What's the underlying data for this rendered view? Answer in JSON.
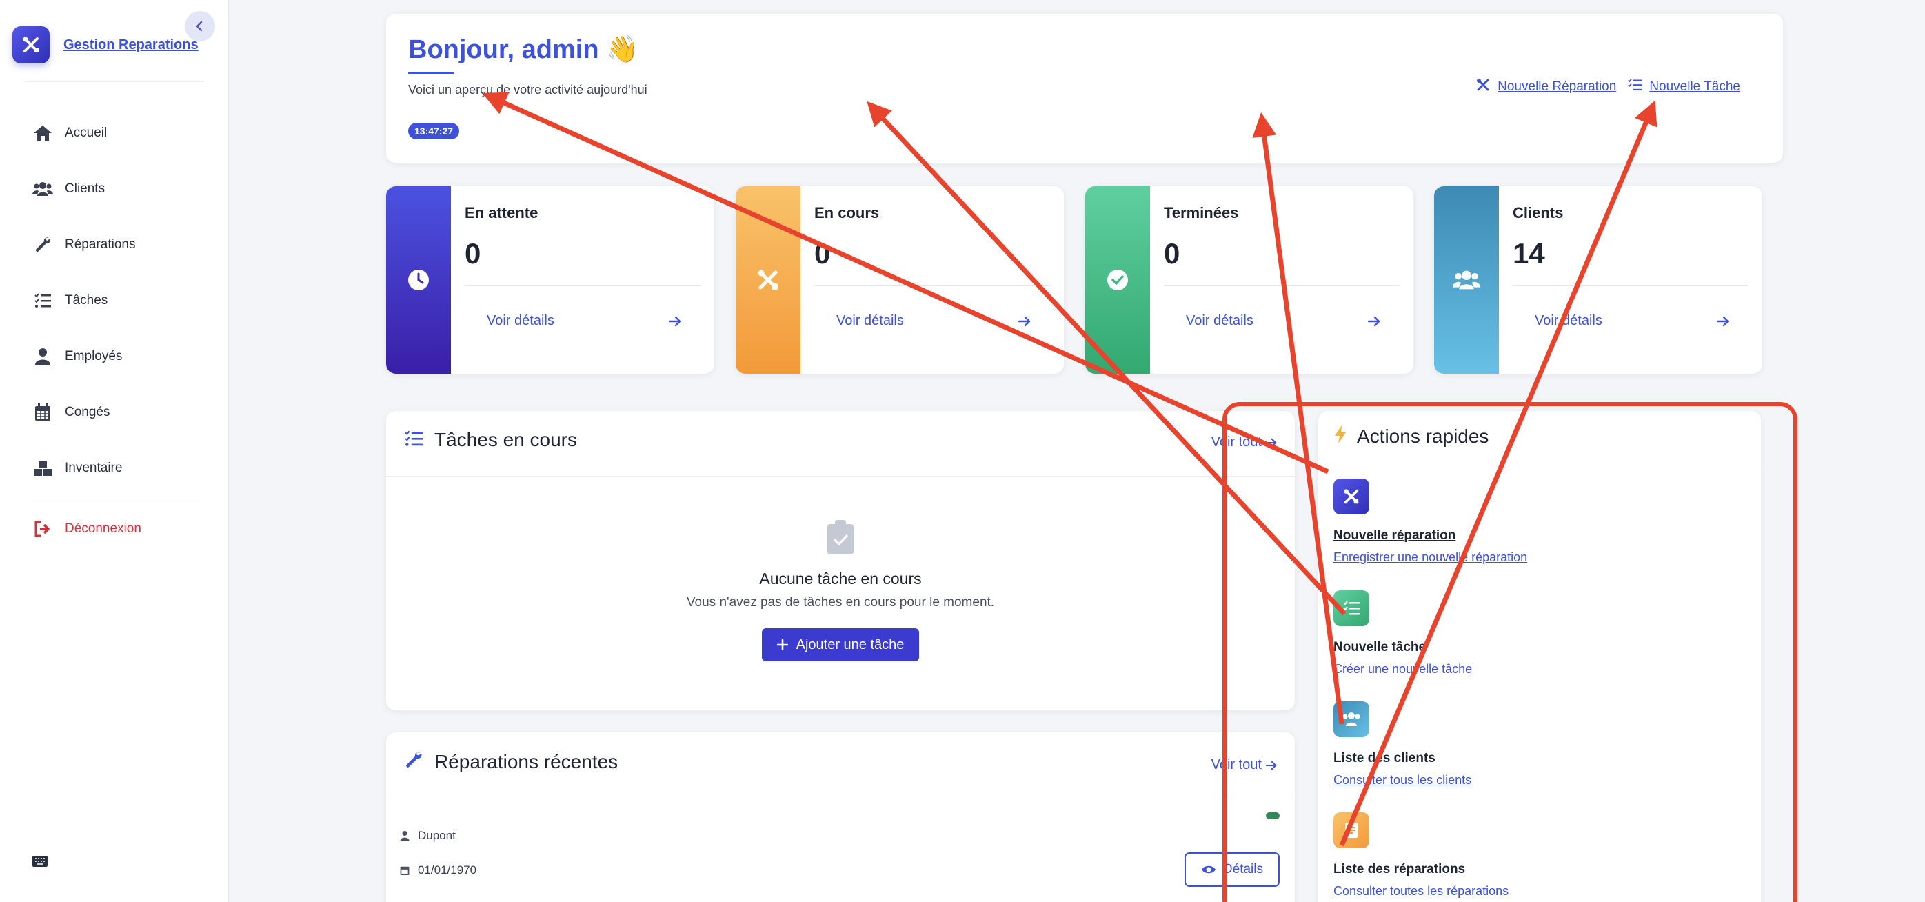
{
  "sidebar": {
    "brand": "Gestion Reparations",
    "items": [
      {
        "label": "Accueil",
        "icon": "home-icon"
      },
      {
        "label": "Clients",
        "icon": "users-icon"
      },
      {
        "label": "Réparations",
        "icon": "wrench-icon"
      },
      {
        "label": "Tâches",
        "icon": "tasks-icon"
      },
      {
        "label": "Employés",
        "icon": "user-icon"
      },
      {
        "label": "Congés",
        "icon": "calendar-icon"
      },
      {
        "label": "Inventaire",
        "icon": "boxes-icon"
      }
    ],
    "logout": "Déconnexion"
  },
  "header": {
    "greeting": "Bonjour, admin 👋",
    "subtitle": "Voici un aperçu de votre activité aujourd'hui",
    "time": "13:47:27",
    "links": {
      "new_repair": "Nouvelle Réparation",
      "new_task": "Nouvelle Tâche"
    }
  },
  "stats": [
    {
      "title": "En attente",
      "value": "0",
      "link": "Voir détails",
      "color": "#3b2bb3"
    },
    {
      "title": "En cours",
      "value": "0",
      "link": "Voir détails",
      "color": "#f5a942"
    },
    {
      "title": "Terminées",
      "value": "0",
      "link": "Voir détails",
      "color": "#3fb884"
    },
    {
      "title": "Clients",
      "value": "14",
      "link": "Voir détails",
      "color": "#4ea7cf"
    }
  ],
  "tasks": {
    "title": "Tâches en cours",
    "see_all": "Voir tout",
    "empty_title": "Aucune tâche en cours",
    "empty_text": "Vous n'avez pas de tâches en cours pour le moment.",
    "add_button": "Ajouter une tâche"
  },
  "repairs": {
    "title": "Réparations récentes",
    "see_all": "Voir tout",
    "client": "Dupont",
    "date": "01/01/1970",
    "details_button": "Détails"
  },
  "quick_actions": {
    "title": "Actions rapides",
    "items": [
      {
        "title": "Nouvelle réparation",
        "desc": "Enregistrer une nouvelle réparation",
        "color": "#3b3ccf"
      },
      {
        "title": "Nouvelle tâche",
        "desc": "Créer une nouvelle tâche",
        "color": "#3fb884"
      },
      {
        "title": "Liste des clients",
        "desc": "Consulter tous les clients",
        "color": "#4ea7cf"
      },
      {
        "title": "Liste des réparations",
        "desc": "Consulter toutes les réparations",
        "color": "#f5a942"
      }
    ]
  },
  "colors": {
    "accent": "#3d52d9",
    "annotation": "#e8432d",
    "danger": "#d3343c"
  }
}
